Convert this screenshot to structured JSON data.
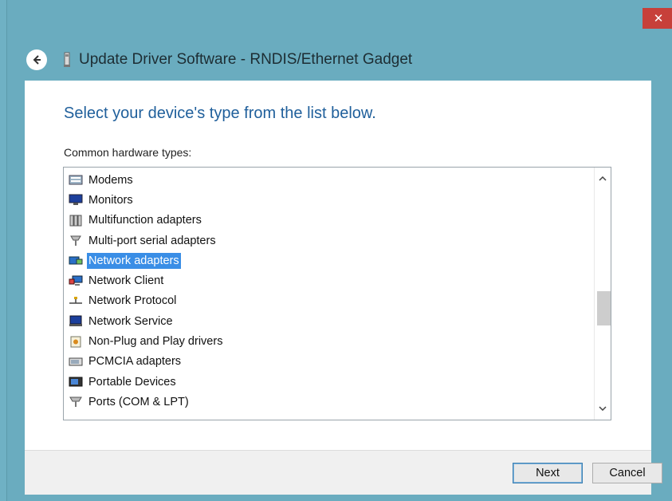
{
  "window": {
    "title": "Update Driver Software - RNDIS/Ethernet Gadget",
    "close_glyph": "✕"
  },
  "dialog": {
    "heading": "Select your device's type from the list below.",
    "list_label": "Common hardware types:",
    "items": [
      {
        "label": "Modems",
        "icon": "modem-icon",
        "selected": false
      },
      {
        "label": "Monitors",
        "icon": "monitor-icon",
        "selected": false
      },
      {
        "label": "Multifunction adapters",
        "icon": "multifunction-icon",
        "selected": false
      },
      {
        "label": "Multi-port serial adapters",
        "icon": "serial-port-icon",
        "selected": false
      },
      {
        "label": "Network adapters",
        "icon": "network-adapter-icon",
        "selected": true
      },
      {
        "label": "Network Client",
        "icon": "network-client-icon",
        "selected": false
      },
      {
        "label": "Network Protocol",
        "icon": "network-protocol-icon",
        "selected": false
      },
      {
        "label": "Network Service",
        "icon": "network-service-icon",
        "selected": false
      },
      {
        "label": "Non-Plug and Play drivers",
        "icon": "non-pnp-icon",
        "selected": false
      },
      {
        "label": "PCMCIA adapters",
        "icon": "pcmcia-icon",
        "selected": false
      },
      {
        "label": "Portable Devices",
        "icon": "portable-device-icon",
        "selected": false
      },
      {
        "label": "Ports (COM & LPT)",
        "icon": "ports-icon",
        "selected": false
      }
    ],
    "scroll_up_glyph": "⌃",
    "scroll_down_glyph": "⌄"
  },
  "footer": {
    "next_label": "Next",
    "cancel_label": "Cancel"
  },
  "colors": {
    "chrome": "#6aacbf",
    "accent_heading": "#1f5f9b",
    "selection": "#3a8ee6",
    "close": "#c7403a"
  }
}
